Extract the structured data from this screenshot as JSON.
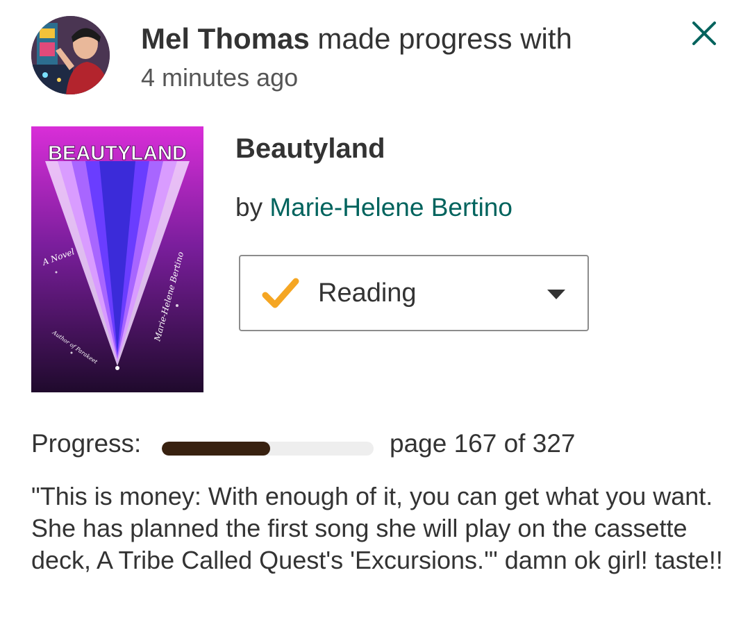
{
  "header": {
    "user_name": "Mel Thomas",
    "action_text": " made progress with",
    "timestamp": "4 minutes ago"
  },
  "book": {
    "title": "Beautyland",
    "by_label": "by ",
    "author": "Marie-Helene Bertino",
    "cover": {
      "title_text": "BEAUTYLAND",
      "subtitle_text": "A Novel",
      "author_text": "Marie-Helene Bertino",
      "blurb_text": "Author of Parakeet"
    }
  },
  "shelf_status": {
    "label": "Reading",
    "check_color": "#f5a623"
  },
  "progress": {
    "label": "Progress:",
    "current_page": 167,
    "total_pages": 327,
    "text": "page 167 of 327",
    "fill_color": "#382110"
  },
  "review": {
    "text": "\"This is money: With enough of it, you can get what you want. She has planned the first song she will play on the cassette deck, A Tribe Called Quest's 'Excursions.'\" damn ok girl! taste!!"
  },
  "icons": {
    "close": "close-icon",
    "check": "check-icon",
    "caret": "caret-down-icon"
  },
  "colors": {
    "accent": "#00635d",
    "text": "#333333"
  }
}
